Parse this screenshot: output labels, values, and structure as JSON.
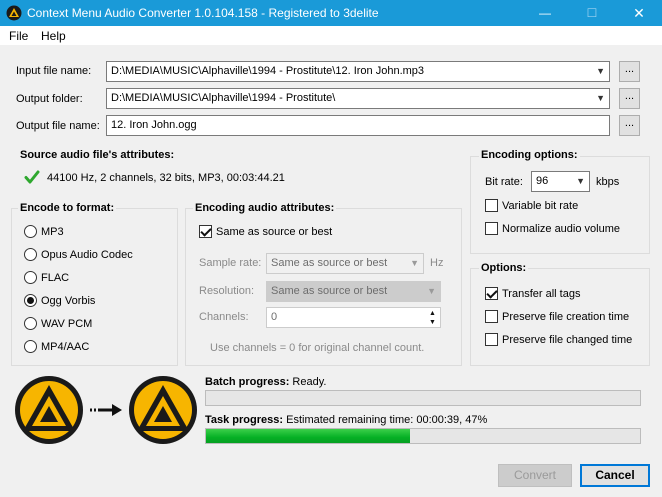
{
  "window": {
    "title": "Context Menu Audio Converter 1.0.104.158 - Registered to 3delite",
    "min_glyph": "—",
    "max_glyph": "☐",
    "close_glyph": "✕"
  },
  "menu": {
    "items": [
      "File",
      "Help"
    ]
  },
  "fields": {
    "input_label": "Input file name:",
    "input_value": "D:\\MEDIA\\MUSIC\\Alphaville\\1994 - Prostitute\\12. Iron John.mp3",
    "output_folder_label": "Output folder:",
    "output_folder_value": "D:\\MEDIA\\MUSIC\\Alphaville\\1994 - Prostitute\\",
    "output_name_label": "Output file name:",
    "output_name_value": "12. Iron John.ogg",
    "browse_label": "..."
  },
  "source": {
    "title": "Source audio file's attributes:",
    "info": "44100 Hz, 2 channels, 32 bits, MP3, 00:03:44.21",
    "status_icon": "checkmark-icon"
  },
  "encode_format": {
    "title": "Encode to format:",
    "options": [
      "MP3",
      "Opus Audio Codec",
      "FLAC",
      "Ogg Vorbis",
      "WAV PCM",
      "MP4/AAC"
    ],
    "selected": "Ogg Vorbis"
  },
  "encoding_attrs": {
    "title": "Encoding audio attributes:",
    "same_as_source_label": "Same as source or best",
    "same_as_source_checked": true,
    "sample_rate_label": "Sample rate:",
    "sample_rate_value": "Same as source or best",
    "sample_rate_unit": "Hz",
    "resolution_label": "Resolution:",
    "resolution_value": "Same as source or best",
    "channels_label": "Channels:",
    "channels_value": "0",
    "hint": "Use channels = 0 for original channel count."
  },
  "encoding_options": {
    "title": "Encoding options:",
    "bitrate_label": "Bit rate:",
    "bitrate_value": "96",
    "bitrate_unit": "kbps",
    "vbr_label": "Variable bit rate",
    "vbr_checked": false,
    "normalize_label": "Normalize audio volume",
    "normalize_checked": false
  },
  "options": {
    "title": "Options:",
    "transfer_tags_label": "Transfer all tags",
    "transfer_tags_checked": true,
    "preserve_creation_label": "Preserve file creation time",
    "preserve_creation_checked": false,
    "preserve_changed_label": "Preserve file changed time",
    "preserve_changed_checked": false
  },
  "progress": {
    "batch_label": "Batch progress:",
    "batch_status": "Ready.",
    "batch_fraction": 0.0,
    "task_label": "Task progress:",
    "task_status": "Estimated remaining time: 00:00:39, 47%",
    "task_fraction": 0.47
  },
  "graphic": {
    "arrow": "→",
    "left_logo": "aimp-logo-icon",
    "right_logo": "aimp-logo-icon"
  },
  "buttons": {
    "convert": "Convert",
    "cancel": "Cancel"
  },
  "colors": {
    "titlebar": "#1a9ad8",
    "progress_fill": "#06b025",
    "accent": "#0078d7",
    "logo_yellow": "#f7b500",
    "logo_dark": "#1a1a1a"
  }
}
